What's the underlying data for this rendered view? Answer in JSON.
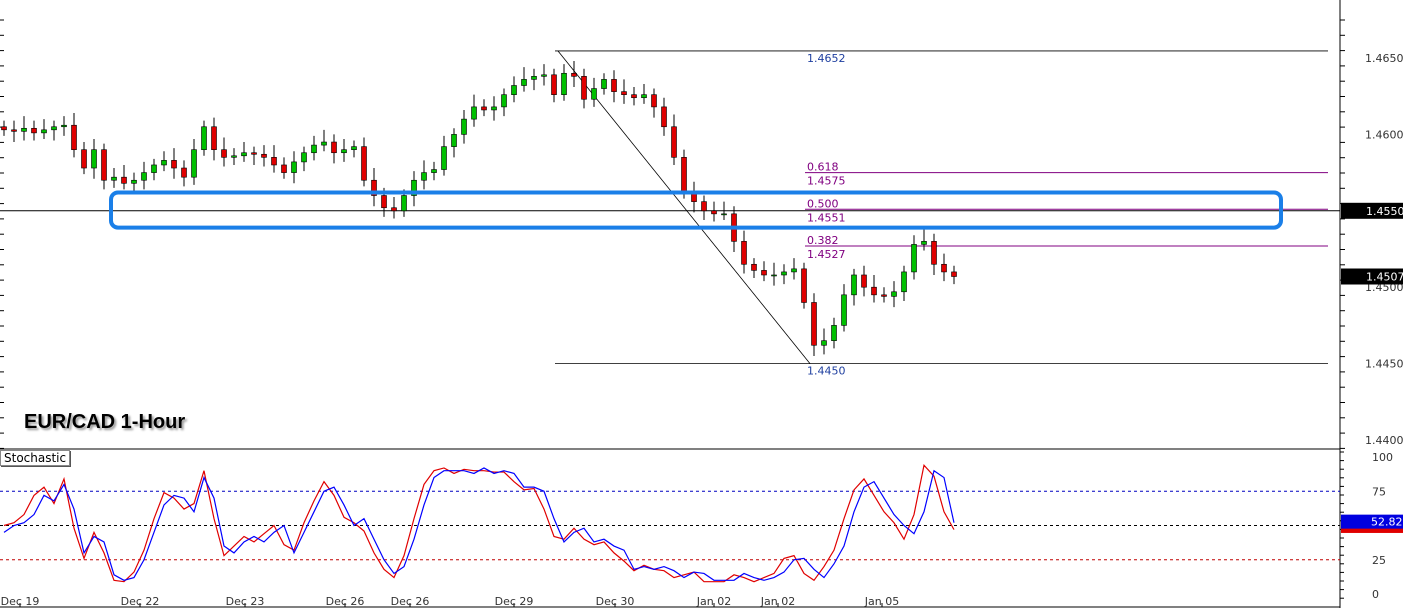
{
  "chart_data": [
    {
      "type": "candlestick",
      "title": "EUR/CAD 1-Hour",
      "ylim": [
        1.4385,
        1.469
      ],
      "yticks": [
        "1.4650",
        "1.4600",
        "1.4500",
        "1.4450",
        "1.4400"
      ],
      "closes": [
        1.4603,
        1.4602,
        1.4604,
        1.4601,
        1.4603,
        1.4605,
        1.4606,
        1.459,
        1.4578,
        1.459,
        1.457,
        1.4572,
        1.4568,
        1.457,
        1.4575,
        1.458,
        1.4583,
        1.4578,
        1.4572,
        1.459,
        1.4605,
        1.459,
        1.4585,
        1.4586,
        1.4588,
        1.4587,
        1.4585,
        1.458,
        1.4575,
        1.4582,
        1.4588,
        1.4593,
        1.4595,
        1.4588,
        1.459,
        1.4592,
        1.457,
        1.456,
        1.4552,
        1.455,
        1.456,
        1.457,
        1.4575,
        1.4577,
        1.4592,
        1.46,
        1.461,
        1.4618,
        1.4616,
        1.4618,
        1.4626,
        1.4632,
        1.4636,
        1.4638,
        1.4639,
        1.4626,
        1.464,
        1.4638,
        1.4623,
        1.463,
        1.4636,
        1.4628,
        1.4626,
        1.4624,
        1.4626,
        1.4618,
        1.4605,
        1.4585,
        1.4562,
        1.4556,
        1.455,
        1.4548,
        1.4548,
        1.453,
        1.4515,
        1.4511,
        1.4508,
        1.4508,
        1.451,
        1.4512,
        1.449,
        1.4462,
        1.4465,
        1.4475,
        1.4495,
        1.4508,
        1.45,
        1.4495,
        1.4494,
        1.4497,
        1.451,
        1.4528,
        1.453,
        1.4515,
        1.451,
        1.4507
      ],
      "horizontal_line": {
        "value": 1.455,
        "label": "1.4550"
      },
      "current_price": {
        "value": 1.4507,
        "label": "1.4507"
      },
      "fibonacci": {
        "high": {
          "value": 1.4652,
          "label": "1.4652"
        },
        "low": {
          "value": 1.445,
          "label": "1.4450"
        },
        "levels": [
          {
            "ratio": "0.618",
            "value": 1.4575,
            "label": "1.4575"
          },
          {
            "ratio": "0.500",
            "value": 1.4551,
            "label": "1.4551"
          },
          {
            "ratio": "0.382",
            "value": 1.4527,
            "label": "1.4527"
          }
        ]
      },
      "highlight_zone": [
        1.4539,
        1.4562
      ],
      "colors": {
        "up": "#00c000",
        "down": "#e00000",
        "fib": "#800080",
        "zone": "#1a7fe8"
      }
    },
    {
      "type": "line",
      "title": "Stochastic",
      "ylim": [
        0,
        100
      ],
      "yticks": [
        "100",
        "75",
        "25",
        "0"
      ],
      "levels": [
        75,
        50,
        25
      ],
      "series": [
        {
          "name": "main",
          "color": "#0000ff",
          "values": [
            45,
            50,
            52,
            58,
            72,
            68,
            80,
            62,
            30,
            42,
            38,
            14,
            10,
            12,
            25,
            45,
            65,
            72,
            70,
            60,
            85,
            70,
            35,
            30,
            38,
            42,
            38,
            45,
            50,
            30,
            45,
            60,
            75,
            78,
            65,
            50,
            55,
            40,
            25,
            15,
            20,
            40,
            65,
            85,
            90,
            90,
            90,
            88,
            92,
            88,
            90,
            88,
            78,
            78,
            75,
            55,
            38,
            45,
            48,
            38,
            40,
            35,
            32,
            18,
            20,
            18,
            20,
            17,
            12,
            16,
            15,
            10,
            10,
            10,
            15,
            12,
            10,
            12,
            16,
            25,
            26,
            18,
            12,
            22,
            35,
            60,
            78,
            82,
            70,
            58,
            50,
            44,
            60,
            90,
            85,
            52
          ]
        },
        {
          "name": "signal",
          "color": "#e00000",
          "values": [
            50,
            52,
            58,
            72,
            78,
            66,
            84,
            48,
            26,
            45,
            30,
            10,
            9,
            16,
            32,
            55,
            74,
            70,
            62,
            66,
            90,
            55,
            28,
            35,
            42,
            38,
            44,
            50,
            36,
            32,
            52,
            68,
            82,
            72,
            56,
            52,
            46,
            30,
            18,
            12,
            28,
            55,
            80,
            90,
            92,
            88,
            91,
            90,
            90,
            89,
            89,
            82,
            76,
            77,
            62,
            42,
            40,
            48,
            40,
            36,
            38,
            30,
            24,
            17,
            21,
            18,
            17,
            12,
            14,
            16,
            9,
            9,
            9,
            14,
            12,
            9,
            12,
            15,
            26,
            28,
            15,
            10,
            20,
            32,
            55,
            76,
            84,
            72,
            60,
            52,
            40,
            58,
            94,
            86,
            60,
            47
          ]
        }
      ],
      "current_values": {
        "main": "52.82",
        "signal": "47.48"
      },
      "x_labels": [
        {
          "label": "Dec 19",
          "index": 1.6
        },
        {
          "label": "Dec 22",
          "index": 13.6
        },
        {
          "label": "Dec 23",
          "index": 24.1
        },
        {
          "label": "Dec 26",
          "index": 34.1
        },
        {
          "label": "Dec 26",
          "index": 40.6
        },
        {
          "label": "Dec 29",
          "index": 51
        },
        {
          "label": "Dec 30",
          "index": 61.1
        },
        {
          "label": "Jan 02",
          "index": 71
        },
        {
          "label": "Jan 02",
          "index": 77.4
        },
        {
          "label": "Jan 05",
          "index": 87.8
        }
      ]
    }
  ]
}
